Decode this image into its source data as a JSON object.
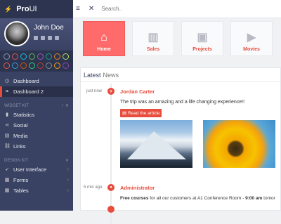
{
  "brand": {
    "name_bold": "Pro",
    "name_rest": "UI"
  },
  "user": {
    "name": "John Doe"
  },
  "sidebar": {
    "items_top": [
      {
        "label": "Dashboard",
        "active": false
      },
      {
        "label": "Dashboard 2",
        "active": true
      }
    ],
    "section_widget": "WIDGET KIT",
    "widget_items": [
      {
        "label": "Statistics"
      },
      {
        "label": "Social"
      },
      {
        "label": "Media"
      },
      {
        "label": "Links"
      }
    ],
    "section_design": "DESIGN KIT",
    "design_items": [
      {
        "label": "User Interface"
      },
      {
        "label": "Forms"
      },
      {
        "label": "Tables"
      }
    ]
  },
  "topbar": {
    "search_placeholder": "Search.."
  },
  "tiles": [
    {
      "label": "Home",
      "icon": "home-icon",
      "active": true
    },
    {
      "label": "Sales",
      "icon": "bar-chart-icon",
      "active": false
    },
    {
      "label": "Projects",
      "icon": "briefcase-icon",
      "active": false
    },
    {
      "label": "Movies",
      "icon": "play-icon",
      "active": false
    }
  ],
  "news": {
    "title_bold": "Latest",
    "title_light": "News",
    "entries": [
      {
        "time": "just now",
        "author": "Jordan Carter",
        "text": "The trip was an amazing and a life changing experience!!",
        "button": "Read the article"
      },
      {
        "time": "5 min ago",
        "author": "Administrator",
        "text_bold": "Free courses",
        "text_rest": " for all our customers at A1 Conference Room - ",
        "text_time": "9:00 am",
        "text_tail": " tomor"
      }
    ]
  },
  "colors": {
    "accent": "#e74c3c",
    "sidebar": "#394263",
    "sidebar_dark": "#2d3450"
  }
}
